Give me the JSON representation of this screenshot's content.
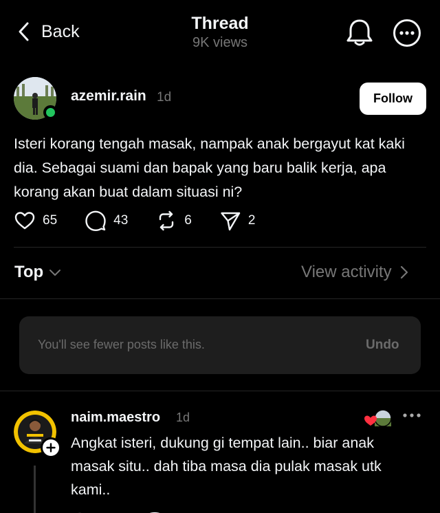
{
  "header": {
    "back_label": "Back",
    "title": "Thread",
    "views": "9K views",
    "bell_icon": "bell-icon",
    "more_icon": "more-circle-icon"
  },
  "post": {
    "username": "azemir.rain",
    "time": "1d",
    "follow_label": "Follow",
    "text": "Isteri korang tengah masak, nampak anak bergayut kat kaki dia. Sebagai suami dan bapak yang baru balik kerja, apa korang akan buat dalam situasi ni?",
    "online_color": "#22c55e",
    "stats": {
      "likes": "65",
      "comments": "43",
      "reposts": "6",
      "shares": "2"
    }
  },
  "sort": {
    "label": "Top",
    "view_activity": "View activity"
  },
  "hidden_notice": {
    "text": "You'll see fewer posts like this.",
    "undo": "Undo"
  },
  "reply": {
    "username": "naim.maestro",
    "time": "1d",
    "text": "Angkat isteri, dukung gi tempat lain.. biar anak masak situ.. dah tiba masa dia pulak masak utk kami..",
    "liked_by_author_color": "#ff3040"
  },
  "colors": {
    "background": "#000000",
    "text": "#f3f5f7",
    "muted": "#777777",
    "card": "#1e1e1e"
  }
}
